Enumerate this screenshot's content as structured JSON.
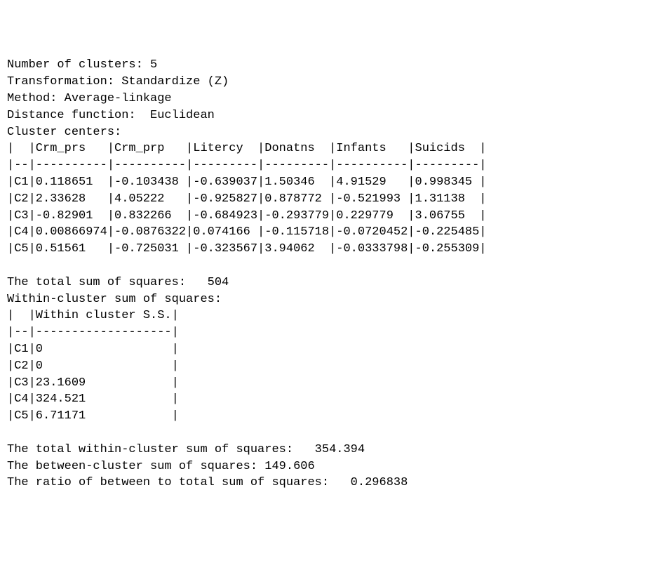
{
  "header": {
    "num_clusters_label": "Number of clusters:",
    "num_clusters_value": "5",
    "transformation_label": "Transformation:",
    "transformation_value": "Standardize (Z)",
    "method_label": "Method:",
    "method_value": "Average-linkage",
    "distance_label": "Distance function:",
    "distance_value": "Euclidean",
    "centers_label": "Cluster centers:"
  },
  "centers_table": {
    "columns": [
      "Crm_prs",
      "Crm_prp",
      "Litercy",
      "Donatns",
      "Infants",
      "Suicids"
    ],
    "rows": [
      {
        "id": "C1",
        "vals": [
          "0.118651",
          "-0.103438",
          "-0.639037",
          "1.50346",
          "4.91529",
          "0.998345"
        ]
      },
      {
        "id": "C2",
        "vals": [
          "2.33628",
          "4.05222",
          "-0.925827",
          "0.878772",
          "-0.521993",
          "1.31138"
        ]
      },
      {
        "id": "C3",
        "vals": [
          "-0.82901",
          "0.832266",
          "-0.684923",
          "-0.293779",
          "0.229779",
          "3.06755"
        ]
      },
      {
        "id": "C4",
        "vals": [
          "0.00866974",
          "-0.0876322",
          "0.074166",
          "-0.115718",
          "-0.0720452",
          "-0.225485"
        ]
      },
      {
        "id": "C5",
        "vals": [
          "0.51561",
          "-0.725031",
          "-0.323567",
          "3.94062",
          "-0.0333798",
          "-0.255309"
        ]
      }
    ]
  },
  "total_ss_label": "The total sum of squares:",
  "total_ss_value": "504",
  "within_label": "Within-cluster sum of squares:",
  "within_table": {
    "column": "Within cluster S.S.",
    "rows": [
      {
        "id": "C1",
        "val": "0"
      },
      {
        "id": "C2",
        "val": "0"
      },
      {
        "id": "C3",
        "val": "23.1609"
      },
      {
        "id": "C4",
        "val": "324.521"
      },
      {
        "id": "C5",
        "val": "6.71171"
      }
    ]
  },
  "total_within_label": "The total within-cluster sum of squares:",
  "total_within_value": "354.394",
  "between_label": "The between-cluster sum of squares:",
  "between_value": "149.606",
  "ratio_label": "The ratio of between to total sum of squares:",
  "ratio_value": "0.296838"
}
